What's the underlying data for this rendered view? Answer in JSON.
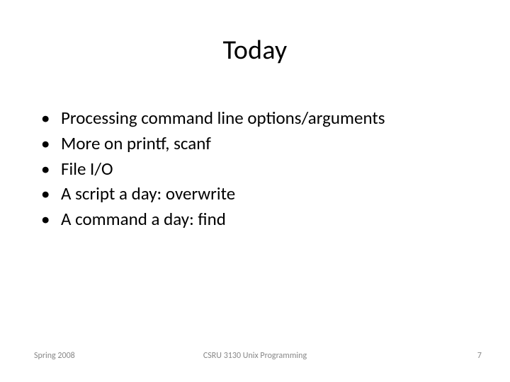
{
  "title": "Today",
  "bullets": [
    "Processing command line options/arguments",
    "More on printf, scanf",
    "File I/O",
    "A script a day: overwrite",
    "A command a day: find"
  ],
  "footer": {
    "left": "Spring 2008",
    "center": "CSRU 3130 Unix Programming",
    "right": "7"
  }
}
